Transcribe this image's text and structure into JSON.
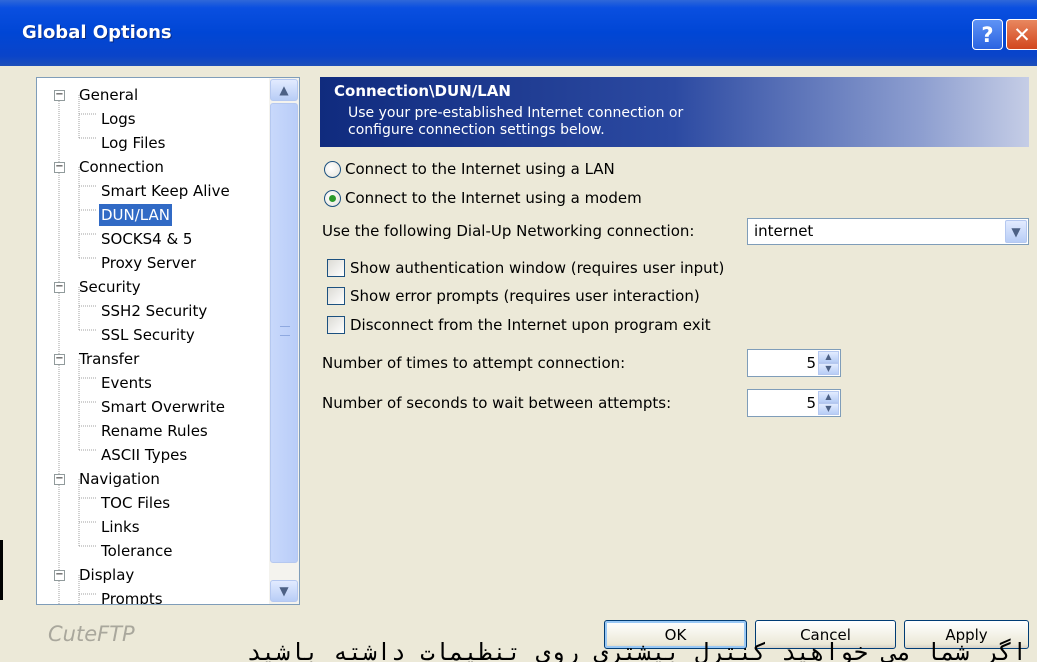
{
  "window": {
    "title": "Global Options",
    "help_glyph": "?",
    "close_glyph": "✕"
  },
  "tree": {
    "items": [
      {
        "label": "General",
        "level": 0
      },
      {
        "label": "Logs",
        "level": 1
      },
      {
        "label": "Log Files",
        "level": 1
      },
      {
        "label": "Connection",
        "level": 0
      },
      {
        "label": "Smart Keep Alive",
        "level": 1
      },
      {
        "label": "DUN/LAN",
        "level": 1,
        "selected": true
      },
      {
        "label": "SOCKS4 & 5",
        "level": 1
      },
      {
        "label": "Proxy Server",
        "level": 1
      },
      {
        "label": "Security",
        "level": 0
      },
      {
        "label": "SSH2 Security",
        "level": 1
      },
      {
        "label": "SSL Security",
        "level": 1
      },
      {
        "label": "Transfer",
        "level": 0
      },
      {
        "label": "Events",
        "level": 1
      },
      {
        "label": "Smart Overwrite",
        "level": 1
      },
      {
        "label": "Rename Rules",
        "level": 1
      },
      {
        "label": "ASCII Types",
        "level": 1
      },
      {
        "label": "Navigation",
        "level": 0
      },
      {
        "label": "TOC Files",
        "level": 1
      },
      {
        "label": "Links",
        "level": 1
      },
      {
        "label": "Tolerance",
        "level": 1
      },
      {
        "label": "Display",
        "level": 0
      },
      {
        "label": "Prompts",
        "level": 1
      }
    ]
  },
  "panel": {
    "title": "Connection\\DUN/LAN",
    "description_line1": "Use your pre-established Internet connection or",
    "description_line2": "configure connection settings below.",
    "radio_lan": "Connect to the Internet using a LAN",
    "radio_modem": "Connect to the Internet using a modem",
    "dialup_label": "Use the following Dial-Up Networking connection:",
    "dialup_value": "internet",
    "check_auth": "Show authentication window (requires user input)",
    "check_errors": "Show error prompts (requires user interaction)",
    "check_disconnect": "Disconnect from the Internet upon program exit",
    "attempts_label": "Number of times to attempt connection:",
    "attempts_value": "5",
    "wait_label": "Number of seconds to wait between attempts:",
    "wait_value": "5"
  },
  "brand": "CuteFTP",
  "buttons": {
    "ok": "OK",
    "cancel": "Cancel",
    "apply": "Apply"
  },
  "overlay": "اگر شما می خواهید کنترل بیشتری روی تنظیمات داشته باشید"
}
